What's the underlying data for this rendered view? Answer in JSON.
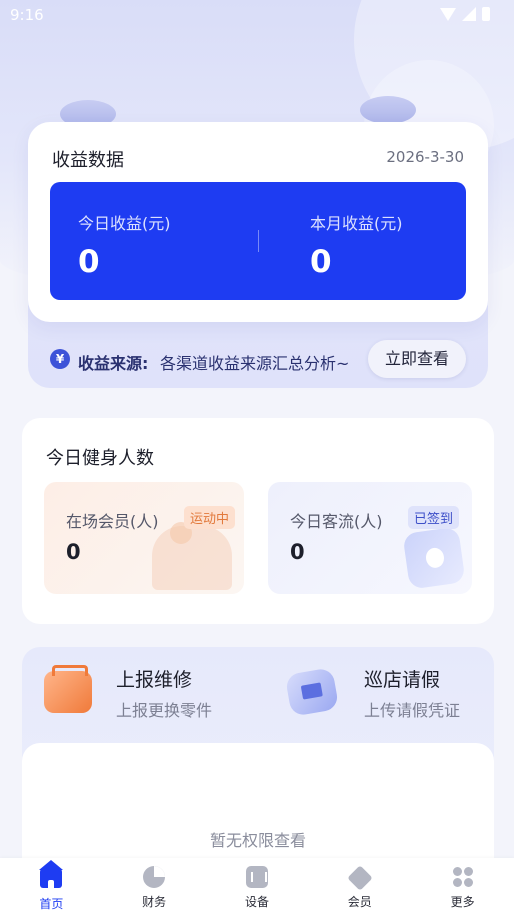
{
  "status_bar": {
    "time": "9:16"
  },
  "earnings": {
    "title": "收益数据",
    "date": "2026-3-30",
    "today_label": "今日收益(元)",
    "today_value": "0",
    "month_label": "本月收益(元)",
    "month_value": "0"
  },
  "source": {
    "icon": "¥",
    "label": "收益来源:",
    "text": "各渠道收益来源汇总分析~",
    "button": "立即查看"
  },
  "fitness": {
    "title": "今日健身人数",
    "members_label": "在场会员(人)",
    "members_value": "0",
    "members_badge": "运动中",
    "visitors_label": "今日客流(人)",
    "visitors_value": "0",
    "visitors_badge": "已签到"
  },
  "actions": {
    "repair_title": "上报维修",
    "repair_sub": "上报更换零件",
    "leave_title": "巡店请假",
    "leave_sub": "上传请假凭证"
  },
  "empty_text": "暂无权限查看",
  "tabs": [
    {
      "label": "首页",
      "icon": "home-icon",
      "active": true
    },
    {
      "label": "财务",
      "icon": "pie-chart-icon",
      "active": false
    },
    {
      "label": "设备",
      "icon": "device-icon",
      "active": false
    },
    {
      "label": "会员",
      "icon": "member-heart-icon",
      "active": false
    },
    {
      "label": "更多",
      "icon": "grid-icon",
      "active": false
    }
  ],
  "colors": {
    "accent": "#1e3cf2",
    "tab_inactive": "#b3b6c2"
  }
}
